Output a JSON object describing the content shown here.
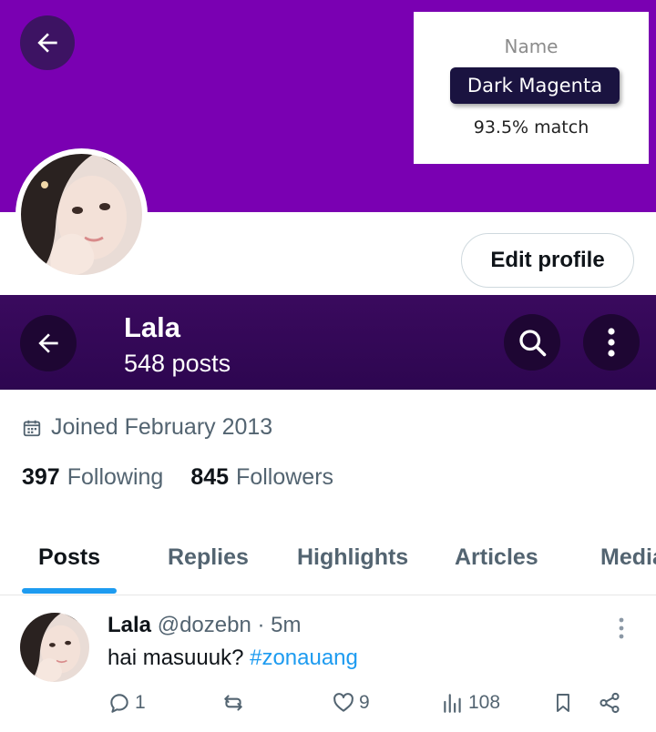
{
  "color_card": {
    "label": "Name",
    "name": "Dark Magenta",
    "match": "93.5% match"
  },
  "colors": {
    "banner": "#7a00b2",
    "header": "#2d0650",
    "accent": "#1d9bf0",
    "muted": "#536471"
  },
  "profile": {
    "edit_label": "Edit profile",
    "name": "Lala",
    "posts_count": "548 posts",
    "joined": "Joined February 2013",
    "following_count": "397",
    "following_label": "Following",
    "followers_count": "845",
    "followers_label": "Followers"
  },
  "tabs": [
    {
      "label": "Posts",
      "active": true
    },
    {
      "label": "Replies"
    },
    {
      "label": "Highlights"
    },
    {
      "label": "Articles"
    },
    {
      "label": "Media"
    }
  ],
  "post": {
    "name": "Lala",
    "meta": "@dozebn · 5m",
    "text": "hai masuuuk? ",
    "hashtag": "#zonauang",
    "replies": "1",
    "likes": "9",
    "views": "108"
  },
  "icons": [
    "back-arrow-icon",
    "search-icon",
    "more-vertical-icon",
    "calendar-icon",
    "reply-icon",
    "retweet-icon",
    "heart-icon",
    "views-icon",
    "bookmark-icon",
    "share-icon"
  ]
}
